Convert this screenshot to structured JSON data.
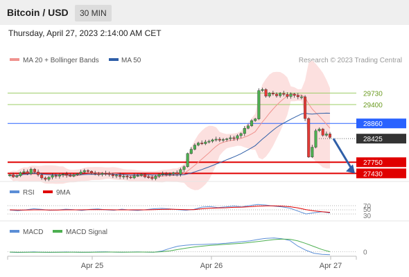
{
  "header": {
    "title": "Bitcoin / USD",
    "timeframe": "30 MIN",
    "datetime": "Thursday, April 27, 2023 2:14:00 AM CET"
  },
  "copyright": "Research © 2023 Trading Central",
  "colors": {
    "ma20": "#f0938f",
    "ma50": "#2f5fa8",
    "bollinger_fill": "#fce0df",
    "candle_up": "#4caf50",
    "candle_down": "#e53935",
    "resistance_line": "#9ccc65",
    "resistance_text": "#6a9a1f",
    "pivot": "#2962ff",
    "support": "#e00000",
    "current_price_bg": "#333333",
    "arrow": "#2f5fa8",
    "rsi": "#5b8ed6",
    "rsi_ma": "#e00000",
    "macd": "#5b8ed6",
    "macd_signal": "#4caf50"
  },
  "chart_data": [
    {
      "type": "candlestick",
      "legend": [
        {
          "name": "MA 20 + Bollinger Bands",
          "color": "#f0938f"
        },
        {
          "name": "MA 50",
          "color": "#2f5fa8"
        }
      ],
      "x_ticks": [
        "Apr 25",
        "Apr 26",
        "Apr 27"
      ],
      "y_range": [
        27200,
        30450
      ],
      "price_close_series": [
        27390,
        27330,
        27360,
        27450,
        27480,
        27420,
        27550,
        27470,
        27390,
        27300,
        27260,
        27320,
        27370,
        27350,
        27390,
        27410,
        27380,
        27350,
        27390,
        27420,
        27470,
        27510,
        27490,
        27440,
        27420,
        27400,
        27430,
        27420,
        27400,
        27360,
        27380,
        27340,
        27350,
        27330,
        27300,
        27360,
        27370,
        27400,
        27330,
        27320,
        27280,
        27350,
        27400,
        27420,
        27400,
        27420,
        27450,
        27410,
        27540,
        27620,
        28000,
        28120,
        28240,
        28300,
        28280,
        28330,
        28350,
        28390,
        28410,
        28380,
        28400,
        28420,
        28450,
        28430,
        28510,
        28570,
        28720,
        28790,
        28940,
        28990,
        29800,
        29830,
        29640,
        29730,
        29700,
        29650,
        29720,
        29690,
        29630,
        29700,
        29660,
        29620,
        29620,
        29000,
        27900,
        28180,
        28650,
        28700,
        28520,
        28560,
        28460
      ],
      "levels": [
        {
          "label": "29730",
          "value": 29730,
          "kind": "resistance"
        },
        {
          "label": "29400",
          "value": 29400,
          "kind": "resistance"
        },
        {
          "label": "28860",
          "value": 28860,
          "kind": "pivot"
        },
        {
          "label": "28425",
          "value": 28425,
          "kind": "current"
        },
        {
          "label": "27750",
          "value": 27750,
          "kind": "support"
        },
        {
          "label": "27430",
          "value": 27430,
          "kind": "support"
        }
      ],
      "forecast_arrow": {
        "from_value": 28425,
        "to_value": 27430
      }
    },
    {
      "type": "line",
      "panel": "RSI",
      "legend": [
        {
          "name": "RSI",
          "color": "#5b8ed6"
        },
        {
          "name": "9MA",
          "color": "#e00000"
        }
      ],
      "y_ticks": [
        "70",
        "50",
        "30"
      ],
      "y_range": [
        0,
        100
      ],
      "series": [
        {
          "name": "RSI",
          "values": [
            49,
            46,
            50,
            55,
            52,
            48,
            49,
            53,
            51,
            47,
            52,
            54,
            50,
            48,
            53,
            49,
            47,
            51,
            55,
            57,
            54,
            51,
            48,
            52,
            63,
            66,
            61,
            64,
            68,
            64,
            71,
            76,
            73,
            68,
            64,
            58,
            44,
            30,
            36,
            41,
            35
          ]
        },
        {
          "name": "9MA",
          "values": [
            50,
            49,
            49,
            50,
            50,
            49,
            49,
            50,
            50,
            50,
            51,
            51,
            51,
            50,
            50,
            50,
            50,
            50,
            51,
            52,
            53,
            52,
            51,
            51,
            55,
            58,
            59,
            60,
            62,
            63,
            65,
            68,
            69,
            69,
            68,
            65,
            59,
            51,
            45,
            41,
            38
          ]
        }
      ]
    },
    {
      "type": "line",
      "panel": "MACD",
      "legend": [
        {
          "name": "MACD",
          "color": "#5b8ed6"
        },
        {
          "name": "MACD Signal",
          "color": "#4caf50"
        }
      ],
      "y_ticks": [
        "0"
      ],
      "y_range": [
        -120,
        400
      ],
      "series": [
        {
          "name": "MACD",
          "values": [
            -10,
            -20,
            -15,
            -5,
            -12,
            -18,
            -14,
            -6,
            -10,
            -16,
            -12,
            -4,
            -2,
            -10,
            -14,
            -8,
            -4,
            -10,
            -12,
            20,
            90,
            150,
            175,
            190,
            195,
            205,
            215,
            230,
            250,
            270,
            290,
            330,
            360,
            370,
            350,
            300,
            150,
            40,
            -40,
            -70,
            -80
          ]
        },
        {
          "name": "MACD Signal",
          "values": [
            -8,
            -12,
            -14,
            -12,
            -12,
            -14,
            -14,
            -12,
            -11,
            -12,
            -12,
            -10,
            -8,
            -8,
            -10,
            -10,
            -9,
            -9,
            -10,
            0,
            25,
            60,
            95,
            125,
            150,
            170,
            185,
            200,
            215,
            230,
            250,
            275,
            300,
            325,
            340,
            335,
            290,
            220,
            140,
            60,
            0
          ]
        }
      ]
    }
  ]
}
